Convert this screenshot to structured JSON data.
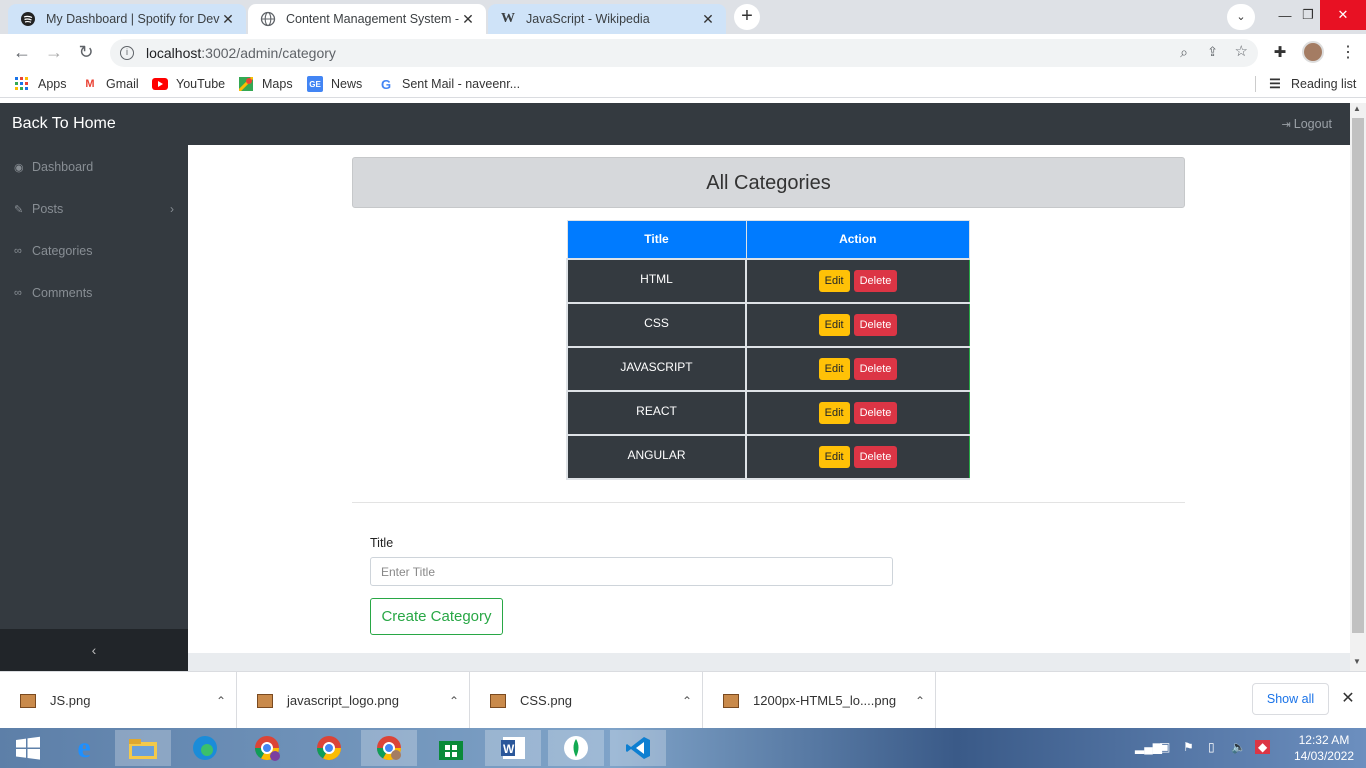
{
  "browser": {
    "tabs": [
      {
        "title": "My Dashboard | Spotify for Deve",
        "icon": "spotify-icon"
      },
      {
        "title": "Content Management System - A",
        "icon": "globe-icon"
      },
      {
        "title": "JavaScript - Wikipedia",
        "icon": "wikipedia-icon"
      }
    ],
    "url_host": "localhost",
    "url_path": ":3002/admin/category",
    "bookmarks": [
      "Apps",
      "Gmail",
      "YouTube",
      "Maps",
      "News",
      "Sent Mail - naveenr..."
    ],
    "reading_list": "Reading list"
  },
  "app": {
    "brand": "Back To Home",
    "logout": "Logout",
    "sidebar": [
      {
        "label": "Dashboard",
        "icon": "dashboard-icon"
      },
      {
        "label": "Posts",
        "icon": "wrench-icon"
      },
      {
        "label": "Categories",
        "icon": "link-icon"
      },
      {
        "label": "Comments",
        "icon": "link-icon"
      }
    ],
    "sidebar_toggle": "‹",
    "heading": "All Categories",
    "table": {
      "headers": [
        "Title",
        "Action"
      ],
      "rows": [
        {
          "title": "HTML"
        },
        {
          "title": "CSS"
        },
        {
          "title": "JAVASCRIPT"
        },
        {
          "title": "REACT"
        },
        {
          "title": "ANGULAR"
        }
      ],
      "edit_label": "Edit",
      "delete_label": "Delete"
    },
    "form": {
      "label": "Title",
      "placeholder": "Enter Title",
      "submit": "Create Category"
    }
  },
  "downloads": {
    "items": [
      "JS.png",
      "javascript_logo.png",
      "CSS.png",
      "1200px-HTML5_lo....png"
    ],
    "show_all": "Show all"
  },
  "taskbar": {
    "time": "12:32 AM",
    "date": "14/03/2022"
  },
  "colors": {
    "primary": "#007bff",
    "dark": "#343a40",
    "warning": "#ffc107",
    "danger": "#dc3545",
    "success": "#28a745"
  }
}
